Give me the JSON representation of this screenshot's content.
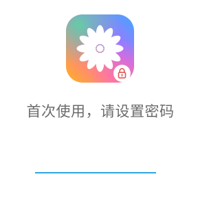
{
  "app_icon": {
    "icon": "photo-gallery-flower-icon",
    "gradient_colors": [
      "#4ea8ff",
      "#8a6bff",
      "#ff7a9c",
      "#ffa22f",
      "#4fd18f"
    ]
  },
  "lock_badge": {
    "icon": "lock-icon",
    "color": "#e25656"
  },
  "prompt": {
    "text": "首次使用，请设置密码"
  },
  "password_field": {
    "value": "",
    "underline_color": "#2aa7e3"
  }
}
